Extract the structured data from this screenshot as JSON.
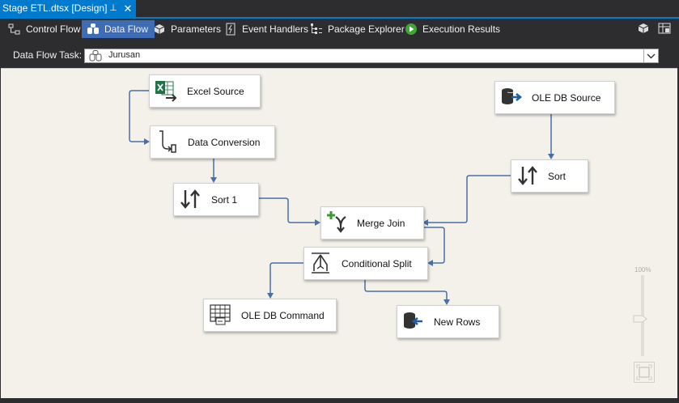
{
  "document_tab": {
    "title": "Stage ETL.dtsx [Design]",
    "pin_icon": "pin-icon",
    "close_icon": "close-icon"
  },
  "designer_tabs": [
    {
      "label": "Control Flow",
      "icon": "control-flow-icon",
      "active": false
    },
    {
      "label": "Data Flow",
      "icon": "data-flow-icon",
      "active": true
    },
    {
      "label": "Parameters",
      "icon": "parameters-icon",
      "active": false
    },
    {
      "label": "Event Handlers",
      "icon": "event-handlers-icon",
      "active": false
    },
    {
      "label": "Package Explorer",
      "icon": "package-explorer-icon",
      "active": false
    },
    {
      "label": "Execution Results",
      "icon": "execution-results-icon",
      "active": false
    }
  ],
  "task_bar": {
    "label": "Data Flow Task:",
    "selected": "Jurusan"
  },
  "components": [
    {
      "label": "Excel Source",
      "icon": "excel-source-icon"
    },
    {
      "label": "Data Conversion",
      "icon": "data-conversion-icon"
    },
    {
      "label": "Sort 1",
      "icon": "sort-icon"
    },
    {
      "label": "OLE DB Source",
      "icon": "oledb-source-icon"
    },
    {
      "label": "Sort",
      "icon": "sort-icon"
    },
    {
      "label": "Merge Join",
      "icon": "merge-join-icon"
    },
    {
      "label": "Conditional Split",
      "icon": "conditional-split-icon"
    },
    {
      "label": "OLE DB Command",
      "icon": "oledb-command-icon"
    },
    {
      "label": "New Rows",
      "icon": "oledb-destination-icon"
    }
  ],
  "zoom": {
    "label": "100%"
  },
  "colors": {
    "accent": "#007acc",
    "active_tab": "#3e6db5",
    "canvas": "#f3f1ea",
    "connector": "#4a6fa5"
  }
}
